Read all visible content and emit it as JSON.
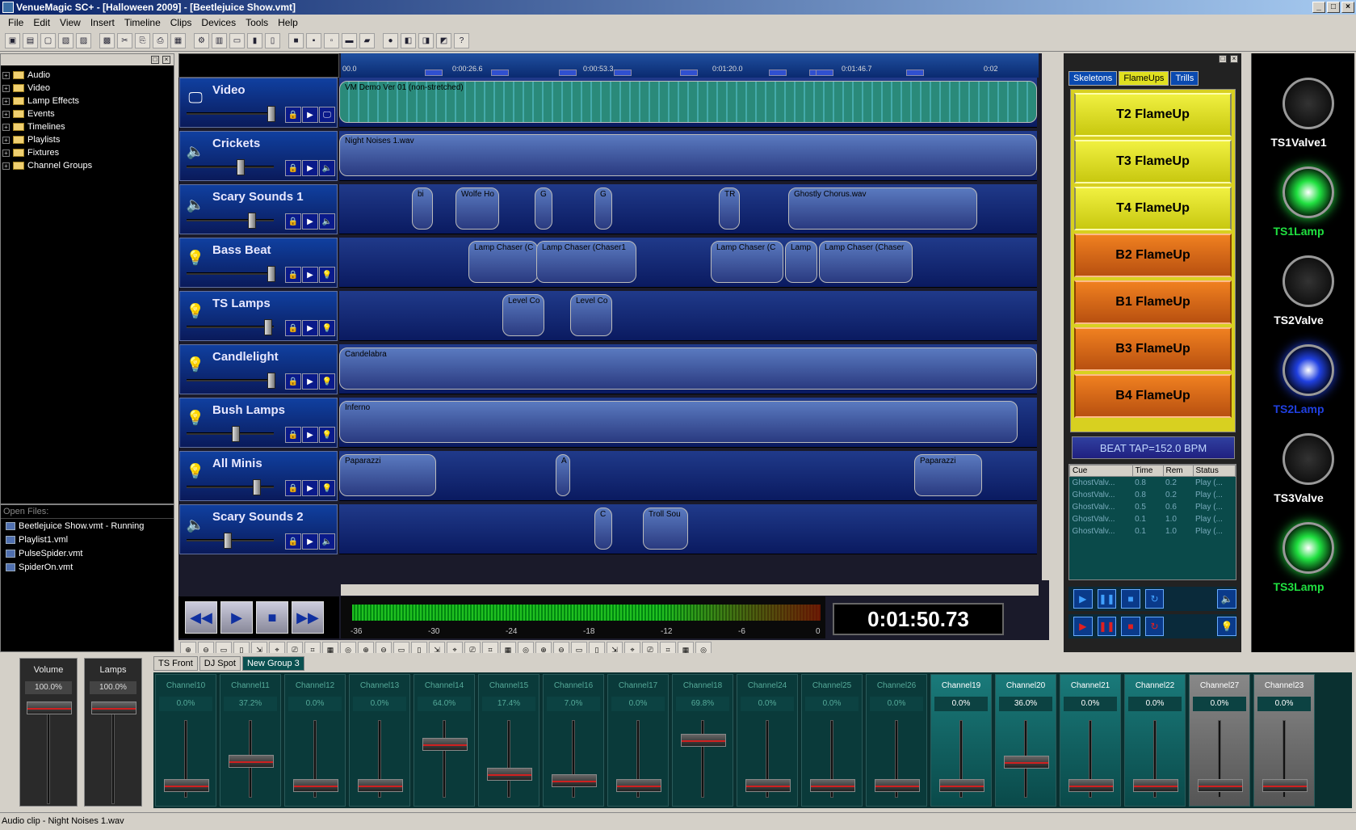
{
  "window": {
    "title": "VenueMagic SC+ - [Halloween 2009] - [Beetlejuice Show.vmt]"
  },
  "menu": [
    "File",
    "Edit",
    "View",
    "Insert",
    "Timeline",
    "Clips",
    "Devices",
    "Tools",
    "Help"
  ],
  "tree": [
    "Audio",
    "Video",
    "Lamp Effects",
    "Events",
    "Timelines",
    "Playlists",
    "Fixtures",
    "Channel Groups"
  ],
  "open_files": {
    "header": "Open Files:",
    "files": [
      "Beetlejuice Show.vmt - Running",
      "Playlist1.vml",
      "PulseSpider.vmt",
      "SpiderOn.vmt"
    ]
  },
  "ruler": {
    "labels": [
      "00.0",
      "0:00:26.6",
      "0:00:53.3",
      "0:01:20.0",
      "0:01:46.7",
      "0:02"
    ]
  },
  "tracks": [
    {
      "name": "Video",
      "icon": "monitor-icon",
      "clips": [
        {
          "label": "VM Demo Ver 01 (non-stretched)"
        }
      ]
    },
    {
      "name": "Crickets",
      "icon": "speaker-icon",
      "clips": [
        {
          "label": "Night Noises 1.wav"
        }
      ]
    },
    {
      "name": "Scary Sounds 1",
      "icon": "speaker-icon",
      "clips": [
        {
          "label": "bi"
        },
        {
          "label": "Wolfe Ho"
        },
        {
          "label": "G"
        },
        {
          "label": "G"
        },
        {
          "label": "TR"
        },
        {
          "label": "Ghostly Chorus.wav"
        }
      ]
    },
    {
      "name": "Bass Beat",
      "icon": "bulb-icon",
      "clips": [
        {
          "label": "Lamp Chaser (C"
        },
        {
          "label": "Lamp Chaser (Chaser1"
        },
        {
          "label": "Lamp Chaser (C"
        },
        {
          "label": "Lamp"
        },
        {
          "label": "Lamp Chaser (Chaser"
        }
      ]
    },
    {
      "name": "TS Lamps",
      "icon": "bulb-icon",
      "clips": [
        {
          "label": "Level Co"
        },
        {
          "label": "Level Co"
        }
      ]
    },
    {
      "name": "Candlelight",
      "icon": "bulb-icon",
      "clips": [
        {
          "label": "Candelabra"
        }
      ]
    },
    {
      "name": "Bush Lamps",
      "icon": "bulb-icon",
      "clips": [
        {
          "label": "Inferno"
        }
      ]
    },
    {
      "name": "All Minis",
      "icon": "bulb-icon",
      "clips": [
        {
          "label": "Paparazzi"
        },
        {
          "label": "A"
        },
        {
          "label": "Paparazzi"
        }
      ]
    },
    {
      "name": "Scary Sounds 2",
      "icon": "speaker-icon",
      "clips": [
        {
          "label": "C"
        },
        {
          "label": "Troll Sou"
        }
      ]
    }
  ],
  "meter": {
    "labels": [
      "-36",
      "-30",
      "-24",
      "-18",
      "-12",
      "-6",
      "0"
    ]
  },
  "clock": "0:01:50.73",
  "cue_tabs": [
    "Skeletons",
    "FlameUps",
    "Trills"
  ],
  "cue_buttons": [
    "T2 FlameUp",
    "T3 FlameUp",
    "T4 FlameUp",
    "B2 FlameUp",
    "B1 FlameUp",
    "B3 FlameUp",
    "B4 FlameUp"
  ],
  "beat_tap": "BEAT TAP=152.0 BPM",
  "cue_list": {
    "columns": [
      "Cue",
      "Time",
      "Rem",
      "Status"
    ],
    "rows": [
      [
        "GhostValv...",
        "0.8",
        "0.2",
        "Play (..."
      ],
      [
        "GhostValv...",
        "0.8",
        "0.2",
        "Play (..."
      ],
      [
        "GhostValv...",
        "0.5",
        "0.6",
        "Play (..."
      ],
      [
        "GhostValv...",
        "0.1",
        "1.0",
        "Play (..."
      ],
      [
        "GhostValv...",
        "0.1",
        "1.0",
        "Play (..."
      ]
    ]
  },
  "lamps": [
    {
      "name": "TS1Valve1",
      "color": "#ffffff",
      "state": "off"
    },
    {
      "name": "TS1Lamp",
      "color": "#20e040",
      "state": "on"
    },
    {
      "name": "TS2Valve",
      "color": "#ffffff",
      "state": "off"
    },
    {
      "name": "TS2Lamp",
      "color": "#2040e0",
      "state": "on"
    },
    {
      "name": "TS3Valve",
      "color": "#ffffff",
      "state": "off"
    },
    {
      "name": "TS3Lamp",
      "color": "#20e040",
      "state": "on"
    }
  ],
  "mixer": {
    "masters": [
      {
        "label": "Volume",
        "value": "100.0%",
        "level": 1.0
      },
      {
        "label": "Lamps",
        "value": "100.0%",
        "level": 1.0
      }
    ],
    "tabs": [
      "TS Front",
      "DJ Spot",
      "New Group 3"
    ],
    "channels": [
      {
        "name": "Channel10",
        "value": "0.0%",
        "level": 0.0
      },
      {
        "name": "Channel11",
        "value": "37.2%",
        "level": 0.372
      },
      {
        "name": "Channel12",
        "value": "0.0%",
        "level": 0.0
      },
      {
        "name": "Channel13",
        "value": "0.0%",
        "level": 0.0
      },
      {
        "name": "Channel14",
        "value": "64.0%",
        "level": 0.64
      },
      {
        "name": "Channel15",
        "value": "17.4%",
        "level": 0.174
      },
      {
        "name": "Channel16",
        "value": "7.0%",
        "level": 0.07
      },
      {
        "name": "Channel17",
        "value": "0.0%",
        "level": 0.0
      },
      {
        "name": "Channel18",
        "value": "69.8%",
        "level": 0.698
      },
      {
        "name": "Channel24",
        "value": "0.0%",
        "level": 0.0
      },
      {
        "name": "Channel25",
        "value": "0.0%",
        "level": 0.0
      },
      {
        "name": "Channel26",
        "value": "0.0%",
        "level": 0.0
      },
      {
        "name": "Channel19",
        "value": "0.0%",
        "level": 0.0
      },
      {
        "name": "Channel20",
        "value": "36.0%",
        "level": 0.36
      },
      {
        "name": "Channel21",
        "value": "0.0%",
        "level": 0.0
      },
      {
        "name": "Channel22",
        "value": "0.0%",
        "level": 0.0
      },
      {
        "name": "Channel27",
        "value": "0.0%",
        "level": 0.0
      },
      {
        "name": "Channel23",
        "value": "0.0%",
        "level": 0.0
      }
    ]
  },
  "status": "Audio clip - Night Noises 1.wav"
}
